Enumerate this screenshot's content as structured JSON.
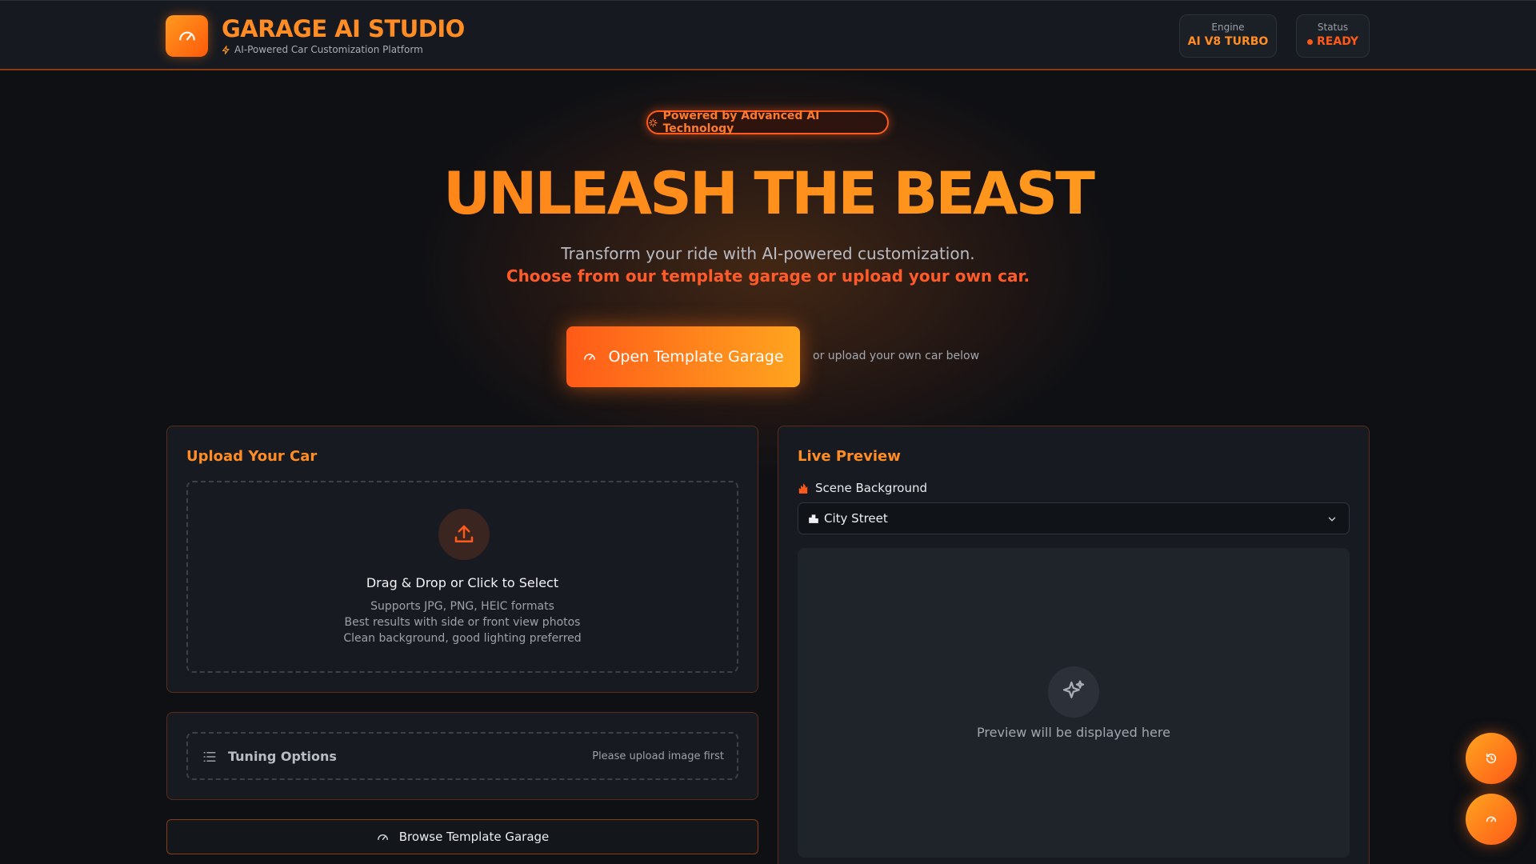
{
  "header": {
    "title": "GARAGE AI STUDIO",
    "subtitle": "AI-Powered Car Customization Platform",
    "engine_label": "Engine",
    "engine_value": "AI V8 TURBO",
    "status_label": "Status",
    "status_value": "READY"
  },
  "hero": {
    "badge": "Powered by Advanced AI Technology",
    "title": "UNLEASH THE BEAST",
    "line1": "Transform your ride with AI-powered customization.",
    "line2": "Choose from our template garage or upload your own car.",
    "cta_label": "Open Template Garage",
    "cta_hint": "or upload your own car below"
  },
  "upload": {
    "title": "Upload Your Car",
    "dropzone_title": "Drag & Drop or Click to Select",
    "hints": [
      "Supports JPG, PNG, HEIC formats",
      "Best results with side or front view photos",
      "Clean background, good lighting preferred"
    ]
  },
  "tuning": {
    "title": "Tuning Options",
    "note": "Please upload image first"
  },
  "browse_button": "Browse Template Garage",
  "preview": {
    "title": "Live Preview",
    "scene_label": "Scene Background",
    "scene_selected": "City Street",
    "placeholder": "Preview will be displayed here"
  },
  "colors": {
    "accent": "#ff8c24",
    "accent_red": "#ff5a1a",
    "background": "#0e1014",
    "panel": "#171b21"
  },
  "icons": {
    "logo": "speedometer-icon",
    "subtitle": "lightning-icon",
    "badge": "sparkle-icon",
    "cta": "speedometer-icon",
    "upload": "upload-icon",
    "tuning": "list-icon",
    "browse": "speedometer-icon",
    "scene": "fire-icon",
    "select": "city-icon",
    "preview": "sparkles-icon",
    "fab_history": "history-icon",
    "fab_garage": "speedometer-icon"
  }
}
